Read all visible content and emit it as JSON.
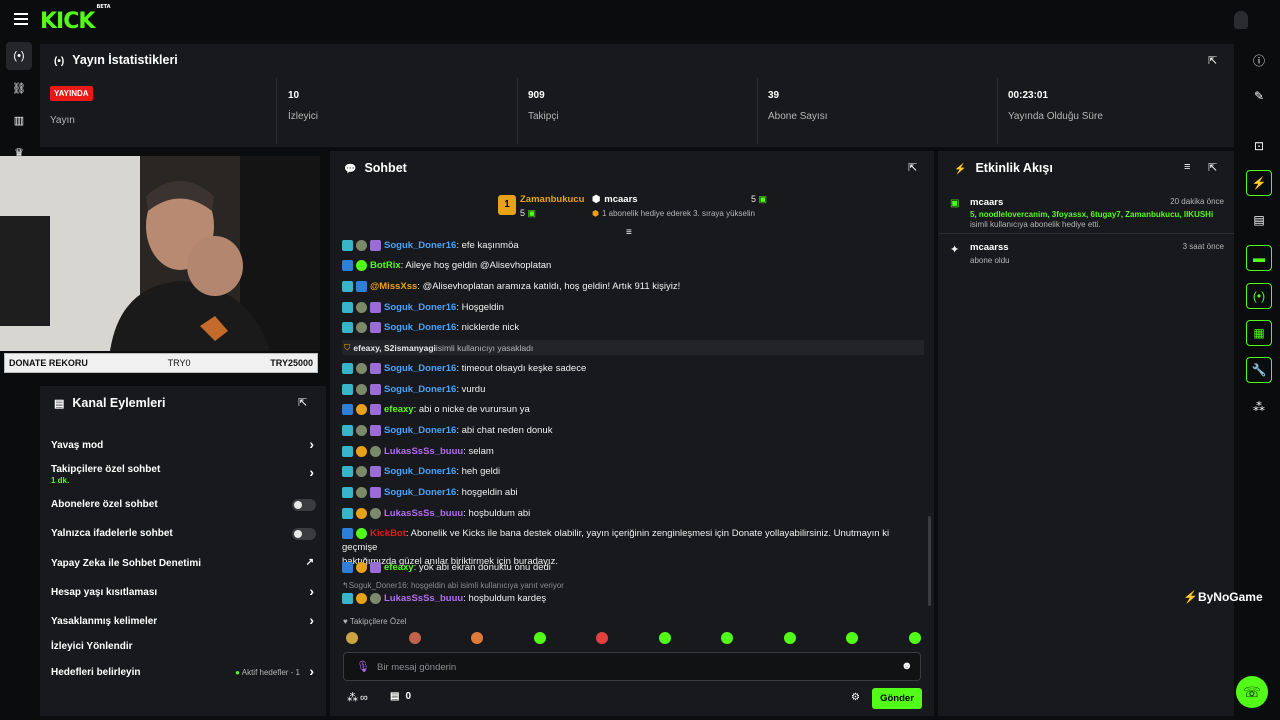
{
  "header": {
    "logo": "KICK",
    "logo_badge": "BETA"
  },
  "stats": {
    "title": "Yayın İstatistikleri",
    "live_badge": "YAYINDA",
    "items": [
      {
        "value": "",
        "label": "Yayın"
      },
      {
        "value": "10",
        "label": "İzleyici"
      },
      {
        "value": "909",
        "label": "Takipçi"
      },
      {
        "value": "39",
        "label": "Abone Sayısı"
      },
      {
        "value": "00:23:01",
        "label": "Yayında Olduğu Süre"
      }
    ]
  },
  "donate": {
    "left": "DONATE REKORU",
    "mid": "TRY0",
    "right": "TRY25000"
  },
  "channel_actions": {
    "title": "Kanal Eylemleri",
    "items": [
      {
        "label": "Yavaş mod",
        "control": "chevron"
      },
      {
        "label": "Takipçilere özel sohbet",
        "sub": "1 dk.",
        "control": "chevron"
      },
      {
        "label": "Abonelere özel sohbet",
        "control": "toggle"
      },
      {
        "label": "Yalnızca ifadelerle sohbet",
        "control": "toggle"
      },
      {
        "label": "Yapay Zeka ile Sohbet Denetimi",
        "control": "external"
      },
      {
        "label": "Hesap yaşı kısıtlaması",
        "control": "chevron"
      },
      {
        "label": "Yasaklanmış kelimeler",
        "control": "chevron"
      },
      {
        "label": "İzleyici Yönlendir",
        "control": "none"
      },
      {
        "label": "Hedefleri belirleyin",
        "control": "chevron",
        "status": "Aktif hedefler - 1"
      }
    ]
  },
  "chat": {
    "title": "Sohbet",
    "leader1": {
      "rank": "1",
      "name": "Zamanbukucu",
      "count": "5"
    },
    "leader2": {
      "name": "mcaars",
      "count": "5",
      "desc": "1 abonelik hediye ederek 3. sıraya yükselin"
    },
    "messages": [
      {
        "user": "Soguk_Doner16",
        "color": "#4aa3ff",
        "text": ": efe kaşınmöa",
        "icons": [
          "sq",
          "gl",
          "pu"
        ]
      },
      {
        "user": "BotRix",
        "color": "#53fc18",
        "text": ": Aileye hoş geldin @Alisevhoplatan",
        "icons": [
          "bl",
          "gr"
        ]
      },
      {
        "user": "@MissXss",
        "color": "#e8a21a",
        "text": ": @Alisevhoplatan aramıza katıldı, hoş geldin! Artık 911 kişiyiz!",
        "icons": [
          "sq",
          "bl"
        ]
      },
      {
        "user": "Soguk_Doner16",
        "color": "#4aa3ff",
        "text": ": Hoşgeldin",
        "icons": [
          "sq",
          "gl",
          "pu"
        ]
      },
      {
        "user": "Soguk_Doner16",
        "color": "#4aa3ff",
        "text": ": nicklerde nick",
        "icons": [
          "sq",
          "gl",
          "pu"
        ]
      },
      {
        "user": "Soguk_Doner16",
        "color": "#4aa3ff",
        "text": ": timeout olsaydı keşke sadece",
        "icons": [
          "sq",
          "gl",
          "pu"
        ]
      },
      {
        "user": "Soguk_Doner16",
        "color": "#4aa3ff",
        "text": ": vurdu",
        "icons": [
          "sq",
          "gl",
          "pu"
        ]
      },
      {
        "user": "efeaxy",
        "color": "#53fc18",
        "text": ": abi o nicke de vurursun ya",
        "icons": [
          "bl",
          "or",
          "pu"
        ]
      },
      {
        "user": "Soguk_Doner16",
        "color": "#4aa3ff",
        "text": ": abi chat neden donuk",
        "icons": [
          "sq",
          "gl",
          "pu"
        ]
      },
      {
        "user": "LukasSsSs_buuu",
        "color": "#b36cf0",
        "text": ": selam",
        "icons": [
          "sq",
          "or",
          "gl"
        ]
      },
      {
        "user": "Soguk_Doner16",
        "color": "#4aa3ff",
        "text": ": heh geldi",
        "icons": [
          "sq",
          "gl",
          "pu"
        ]
      },
      {
        "user": "Soguk_Doner16",
        "color": "#4aa3ff",
        "text": ": hoşgeldin abi",
        "icons": [
          "sq",
          "gl",
          "pu"
        ]
      },
      {
        "user": "LukasSsSs_buuu",
        "color": "#b36cf0",
        "text": ": hoşbuldum abi",
        "icons": [
          "sq",
          "or",
          "gl"
        ]
      }
    ],
    "system_msg": {
      "users": "efeaxy, S2ismanyagi",
      "text": " isimli kullanıcıyı yasakladı"
    },
    "kickbot": {
      "user": "KickBot",
      "text1": ": Abonelik ve Kicks ile bana destek olabilir, yayın içeriğinin zenginleşmesi için Donate yollayabilirsiniz. Unutmayın ki geçmişe",
      "text2": "baktığımızda güzel anılar biriktirmek için buradayız."
    },
    "after": [
      {
        "user": "efeaxy",
        "color": "#53fc18",
        "text": ": yok abi ekran donuktu onu dedi",
        "icons": [
          "bl",
          "or",
          "pu"
        ]
      }
    ],
    "reply_hint": "Soguk_Doner16: hoşgeldin abi isimli kullanıcıya yanıt veriyor",
    "last": {
      "user": "LukasSsSs_buuu",
      "color": "#b36cf0",
      "text": ": hoşbuldum kardeş",
      "icons": [
        "sq",
        "or",
        "gl"
      ]
    },
    "followers_only": "Takipçilere Özel",
    "input_placeholder": "Bir mesaj gönderin",
    "infinity": "∞",
    "coins": "0",
    "send": "Gönder"
  },
  "activity": {
    "title": "Etkinlik Akışı",
    "items": [
      {
        "user": "mcaars",
        "time": "20 dakika önce",
        "highlight": "5, noodlelovercanim, 3foyassx, 6tugay7, Zamanbukucu, IIKUSHi",
        "desc": "isimli kullanıcıya abonelik hediye etti."
      },
      {
        "user": "mcaarss",
        "time": "3 saat önce",
        "desc": "abone oldu"
      }
    ]
  },
  "watermark": "ByNoGame",
  "colors": {
    "accent": "#53fc18",
    "live": "#e91916",
    "panel": "#18191c"
  }
}
